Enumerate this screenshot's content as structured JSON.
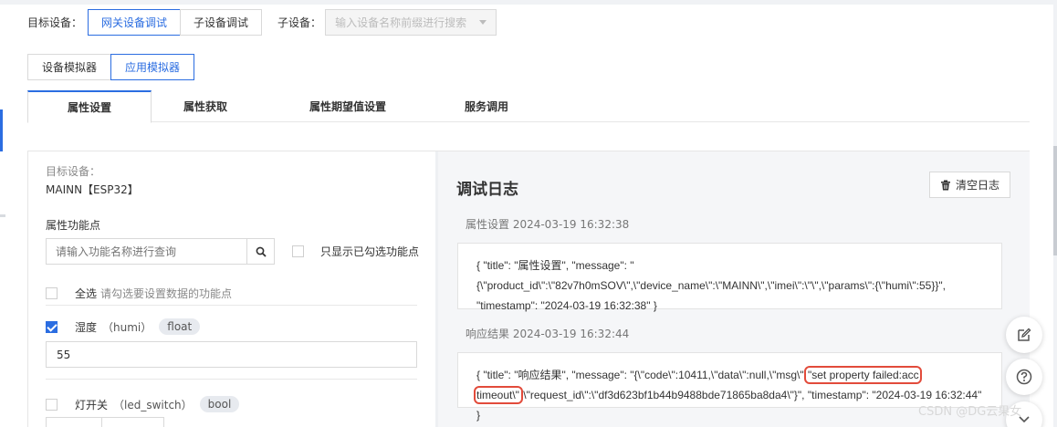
{
  "top": {
    "target_label": "目标设备：",
    "gateway_tab": "网关设备调试",
    "sub_tab": "子设备调试",
    "subdevice_label": "子设备：",
    "subdevice_placeholder": "输入设备名称前缀进行搜索"
  },
  "simulator": {
    "device_sim": "设备模拟器",
    "app_sim": "应用模拟器"
  },
  "tabs": [
    "属性设置",
    "属性获取",
    "属性期望值设置",
    "服务调用"
  ],
  "left": {
    "target_label": "目标设备：",
    "target_value": "MAINN【ESP32】",
    "prop_label": "属性功能点",
    "search_placeholder": "请输入功能名称进行查询",
    "only_selected": "只显示已勾选功能点",
    "select_all": "全选",
    "select_hint": "请勾选要设置数据的功能点",
    "items": [
      {
        "name": "湿度",
        "key": "（humi）",
        "type": "float",
        "value": "55"
      },
      {
        "name": "灯开关",
        "key": "（led_switch）",
        "type": "bool"
      }
    ]
  },
  "log": {
    "title": "调试日志",
    "clear": "清空日志",
    "entries": [
      {
        "head": "属性设置 2024-03-19 16:32:38",
        "body": "{ \"title\": \"属性设置\", \"message\": \"{\\\"product_id\\\":\\\"82v7h0mSOV\\\",\\\"device_name\\\":\\\"MAINN\\\",\\\"imei\\\":\\\"\\\",\\\"params\\\":{\\\"humi\\\":55}}\", \"timestamp\": \"2024-03-19 16:32:38\" }"
      },
      {
        "head": "响应结果 2024-03-19 16:32:44",
        "body_pre": "{ \"title\": \"响应结果\", \"message\": \"{\\\"code\\\":10411,\\\"data\\\":null,\\\"msg\\\":",
        "body_hl": "\"set property failed:acc timeout\\\"",
        "body_post": ",\\\"request_id\\\":\\\"df3d623bf1b44b9488bde71865ba8da4\\\"}\", \"timestamp\": \"2024-03-19 16:32:44\" }"
      }
    ]
  },
  "watermark": "CSDN @DG云果女",
  "colors": {
    "accent": "#2b6de1",
    "highlight": "#e24b3b"
  }
}
